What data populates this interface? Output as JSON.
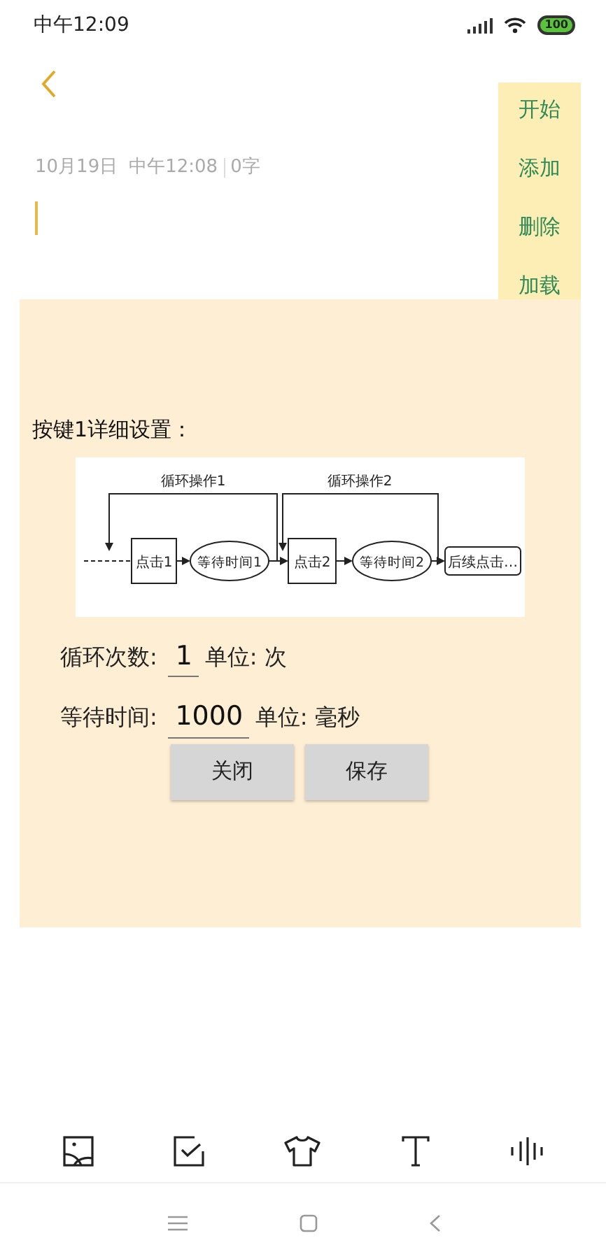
{
  "status_bar": {
    "time": "中午12:09",
    "battery": "100"
  },
  "note": {
    "date": "10月19日",
    "time": "中午12:08",
    "count": "0字"
  },
  "side_menu": {
    "items": [
      "开始",
      "添加",
      "删除",
      "加载"
    ]
  },
  "dialog": {
    "title": "按键1详细设置：",
    "diagram": {
      "loops": [
        "循环操作1",
        "循环操作2"
      ],
      "nodes": [
        {
          "kind": "box",
          "label": "点击1"
        },
        {
          "kind": "ellipse",
          "label": "等待时间1"
        },
        {
          "kind": "box",
          "label": "点击2"
        },
        {
          "kind": "ellipse",
          "label": "等待时间2"
        },
        {
          "kind": "rounded",
          "label": "后续点击…"
        }
      ]
    },
    "fields": [
      {
        "label": "循环次数:",
        "value": "1",
        "unit": "单位: 次"
      },
      {
        "label": "等待时间:",
        "value": "1000",
        "unit": "单位: 毫秒"
      }
    ],
    "buttons": [
      "关闭",
      "保存"
    ]
  }
}
